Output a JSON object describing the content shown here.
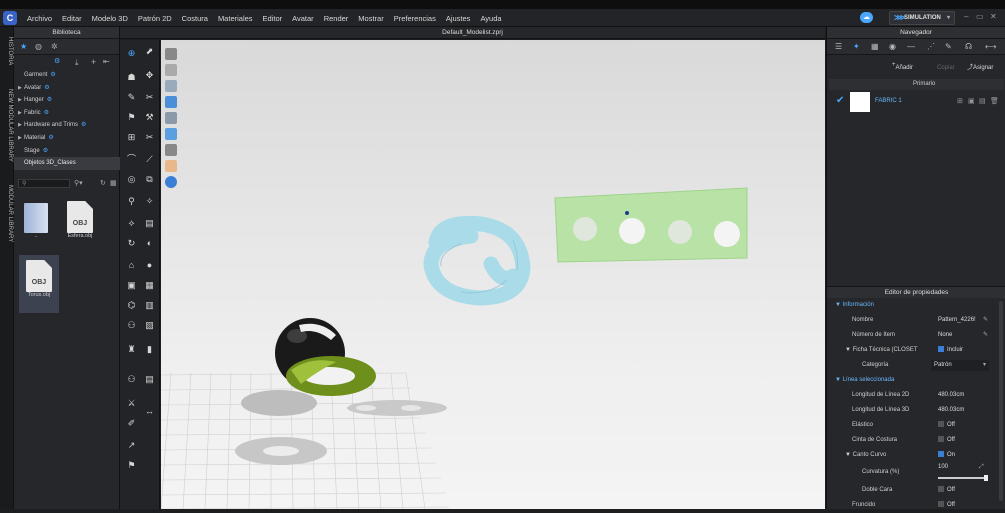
{
  "app": {
    "logo": "C",
    "file_title": "Default_Modelist.zprj"
  },
  "menu": [
    "Archivo",
    "Editar",
    "Modelo 3D",
    "Patrón 2D",
    "Costura",
    "Materiales",
    "Editor",
    "Avatar",
    "Render",
    "Mostrar",
    "Preferencias",
    "Ajustes",
    "Ayuda"
  ],
  "simulation_label": "SIMULATION",
  "side_tabs": [
    "HISTORIA",
    "NEW MODULAR LIBRARY",
    "MODULAR LIBRARY"
  ],
  "library": {
    "title": "Biblioteca",
    "tree": [
      "Garment",
      "Avatar",
      "Hanger",
      "Fabric",
      "Hardware and Trims",
      "Material",
      "Stage",
      "Objetos 3D_Clases"
    ],
    "files": [
      {
        "name": "..",
        "icon": "folder-icon"
      },
      {
        "name": "Esfera.obj",
        "badge": "OBJ"
      },
      {
        "name": "Torus.obj",
        "badge": "OBJ"
      }
    ]
  },
  "navigator": {
    "title": "Navegador",
    "add_label": "Añadir",
    "copy_label": "Copiar",
    "assign_label": "Asignar",
    "tab_label": "Primario",
    "fabric_name": "FABRIC 1"
  },
  "properties": {
    "title": "Editor de propiedades",
    "info_section": "Información",
    "rows": {
      "nombre": {
        "label": "Nombre",
        "value": "Pattern_4226!"
      },
      "numero": {
        "label": "Número de Item",
        "value": "None"
      },
      "ficha": {
        "label": "Ficha Técnica (CLOSET",
        "value": "Incluir"
      },
      "categoria": {
        "label": "Categoría",
        "value": "Patrón"
      }
    },
    "line_section": "Línea seleccionada",
    "line_rows": {
      "l2d": {
        "label": "Longitud de Línea 2D",
        "value": "480.03cm"
      },
      "l3d": {
        "label": "Longitud de Línea 3D",
        "value": "480.03cm"
      },
      "elastico": {
        "label": "Elástico",
        "value": "Off"
      },
      "cinta": {
        "label": "Cinta de Costura",
        "value": "Off"
      },
      "canto": {
        "label": "Canto Curvo",
        "value": "On"
      },
      "curvatura": {
        "label": "Curvatura (%)",
        "value": "100"
      },
      "doble": {
        "label": "Doble Cara",
        "value": "Off"
      },
      "fruncido": {
        "label": "Fruncido",
        "value": "Off"
      }
    }
  },
  "colors": {
    "accent": "#4aa6ff",
    "pattern_green": "#b9e3a6",
    "torus_blue": "#a9dbe9",
    "ring_green": "#7b9e22"
  }
}
